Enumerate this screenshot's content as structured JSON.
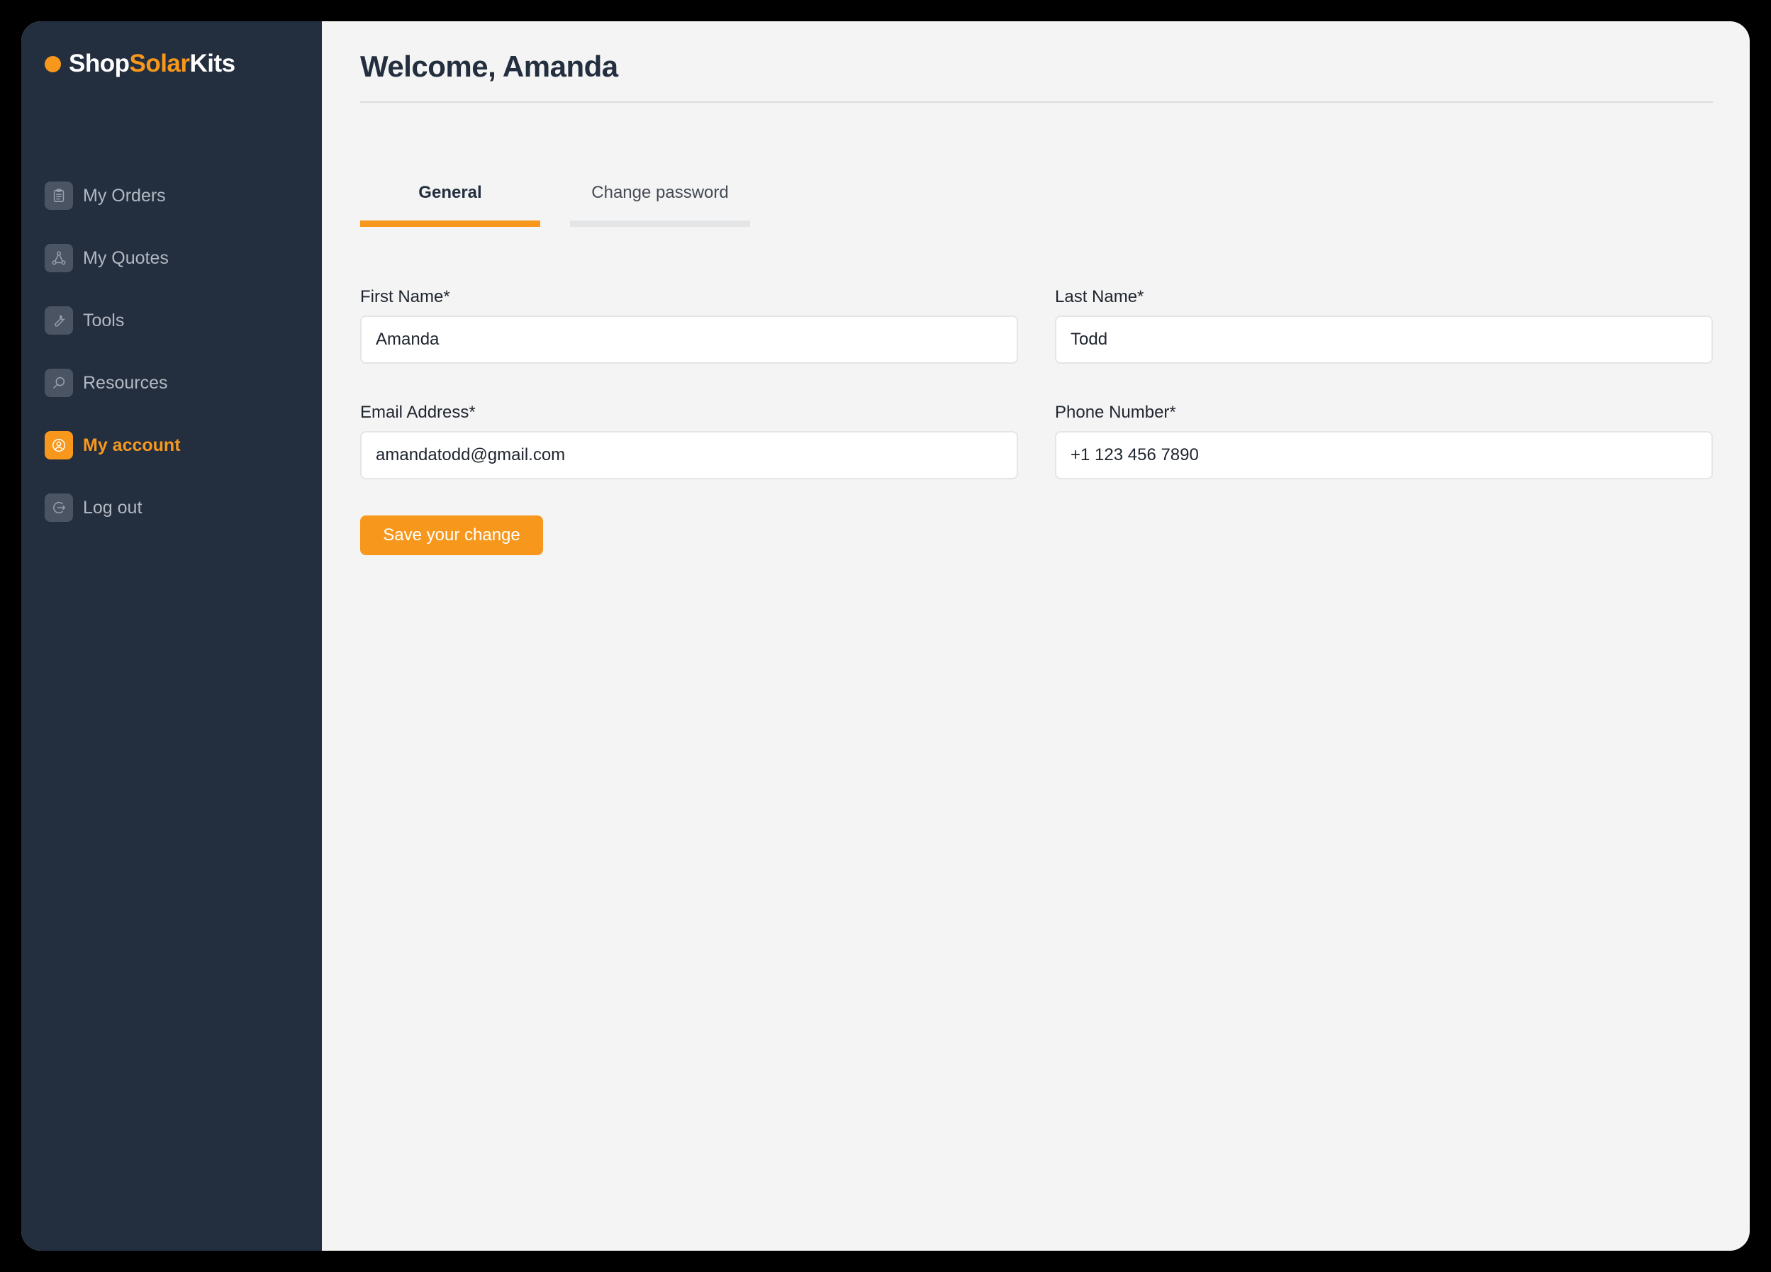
{
  "brand": {
    "name_part1": "Shop",
    "name_part2": "Solar",
    "name_part3": "Kits",
    "accent_color": "#f7981d",
    "sidebar_color": "#232e3f"
  },
  "sidebar": {
    "items": [
      {
        "label": "My Orders",
        "icon": "clipboard-icon",
        "active": false
      },
      {
        "label": "My Quotes",
        "icon": "network-icon",
        "active": false
      },
      {
        "label": "Tools",
        "icon": "wrench-icon",
        "active": false
      },
      {
        "label": "Resources",
        "icon": "search-icon",
        "active": false
      },
      {
        "label": "My account",
        "icon": "user-circle-icon",
        "active": true
      },
      {
        "label": "Log out",
        "icon": "logout-icon",
        "active": false
      }
    ]
  },
  "header": {
    "title": "Welcome, Amanda"
  },
  "tabs": [
    {
      "label": "General",
      "active": true
    },
    {
      "label": "Change password",
      "active": false
    }
  ],
  "form": {
    "first_name": {
      "label": "First Name*",
      "value": "Amanda"
    },
    "last_name": {
      "label": "Last Name*",
      "value": "Todd"
    },
    "email": {
      "label": "Email Address*",
      "value": "amandatodd@gmail.com"
    },
    "phone": {
      "label": "Phone Number*",
      "value": "+1 123 456 7890"
    },
    "save_label": "Save your change"
  }
}
